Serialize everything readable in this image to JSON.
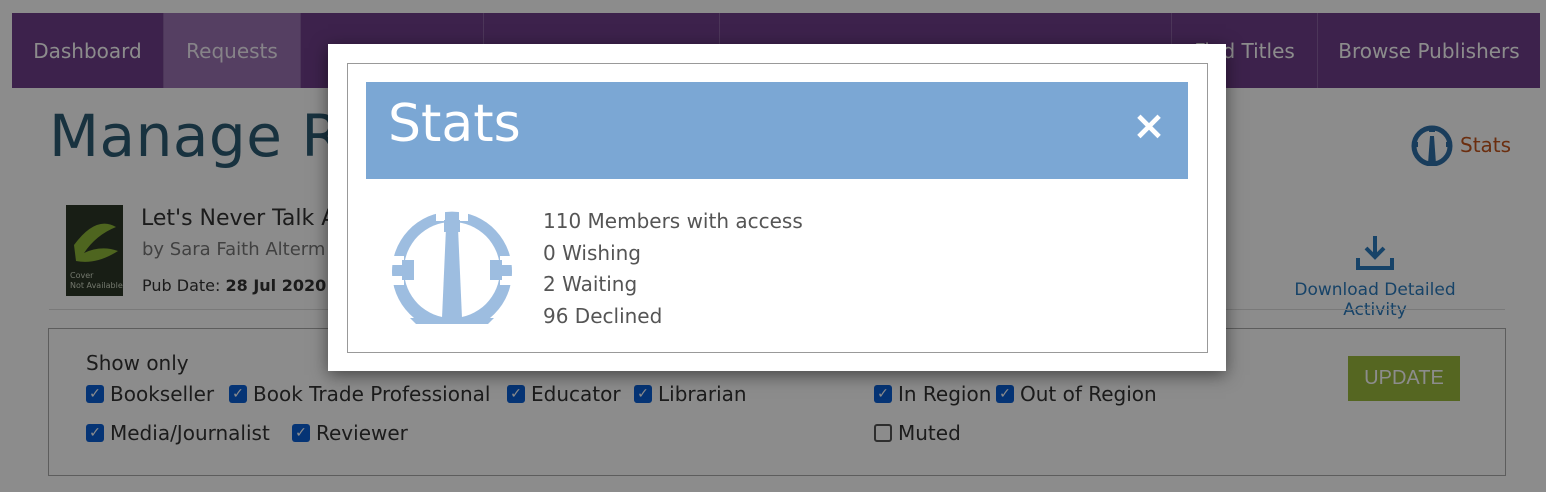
{
  "nav": {
    "items": [
      {
        "label": "Dashboard"
      },
      {
        "label": "Requests"
      },
      {
        "label": "Find Titles"
      },
      {
        "label": "Browse Publishers"
      }
    ]
  },
  "page": {
    "title": "Manage Re",
    "stats_link": "Stats"
  },
  "book": {
    "title": "Let's Never Talk A",
    "author": "by Sara Faith Alterm",
    "pub_date_label": "Pub Date:",
    "pub_date": "28 Jul 2020",
    "cover_text": "Cover\nNot Available"
  },
  "download": {
    "label": "Download Detailed Activity"
  },
  "filters": {
    "show_only": "Show only",
    "checkboxes": [
      {
        "label": "Bookseller",
        "checked": true
      },
      {
        "label": "Book Trade Professional",
        "checked": true
      },
      {
        "label": "Educator",
        "checked": true
      },
      {
        "label": "Librarian",
        "checked": true
      },
      {
        "label": "Media/Journalist",
        "checked": true
      },
      {
        "label": "Reviewer",
        "checked": true
      },
      {
        "label": "In Region",
        "checked": true
      },
      {
        "label": "Out of Region",
        "checked": true
      },
      {
        "label": "Muted",
        "checked": false
      }
    ],
    "update_label": "UPDATE"
  },
  "modal": {
    "title": "Stats",
    "close_label": "×",
    "stats": [
      "110 Members with access",
      "0 Wishing",
      "2 Waiting",
      "96 Declined"
    ]
  },
  "colors": {
    "nav_bg": "#6f3f8b",
    "modal_header": "#7ba7d4",
    "accent_orange": "#c4551c",
    "update_green": "#9cbb3c"
  },
  "icons": [
    "stats-gauge-icon",
    "download-icon",
    "close-icon"
  ]
}
